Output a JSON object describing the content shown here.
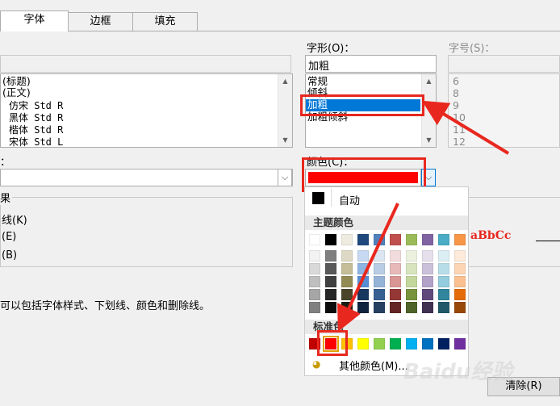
{
  "tabs": [
    {
      "label": "字体",
      "active": true
    },
    {
      "label": "边框",
      "active": false
    },
    {
      "label": "填充",
      "active": false
    }
  ],
  "font_list": {
    "items": [
      "(标题)",
      "(正文)",
      "仿宋 Std R",
      "黑体 Std R",
      "楷体 Std R",
      "宋体 Std L"
    ]
  },
  "style": {
    "label": "字形(O)：",
    "value": "加粗",
    "options": [
      "常规",
      "倾斜",
      "加粗",
      "加粗倾斜"
    ],
    "selected_index": 2
  },
  "size": {
    "label": "字号(S)：",
    "options": [
      "6",
      "8",
      "9",
      "10",
      "11",
      "12"
    ]
  },
  "underline": {
    "label": "：",
    "value": ""
  },
  "color": {
    "label": "颜色(C)：",
    "value_hex": "#ff0000"
  },
  "effects": {
    "label": "果",
    "items": [
      "线(K)",
      "(E)",
      "(B)"
    ]
  },
  "preview": {
    "text": "aBbCc"
  },
  "description": "可以包括字体样式、下划线、颜色和删除线。",
  "palette": {
    "auto_label": "自动",
    "theme_label": "主题颜色",
    "standard_label": "标准色",
    "more_label": "其他颜色(M)...",
    "theme_colors": [
      [
        "#ffffff",
        "#f2f2f2",
        "#d9d9d9",
        "#bfbfbf",
        "#a6a6a6",
        "#808080"
      ],
      [
        "#000000",
        "#7f7f7f",
        "#595959",
        "#404040",
        "#262626",
        "#0d0d0d"
      ],
      [
        "#eeece1",
        "#ddd9c4",
        "#c4bd97",
        "#948a54",
        "#4a452a",
        "#1e1c11"
      ],
      [
        "#1f497d",
        "#c6d9f1",
        "#8eb4e3",
        "#558ed5",
        "#17375e",
        "#10243f"
      ],
      [
        "#4f81bd",
        "#dce6f2",
        "#b9cde5",
        "#95b3d7",
        "#376092",
        "#254061"
      ],
      [
        "#c0504d",
        "#f2dcdb",
        "#e6b9b8",
        "#d99694",
        "#953735",
        "#632523"
      ],
      [
        "#9bbb59",
        "#ebf1de",
        "#d7e4bd",
        "#c3d69b",
        "#77933c",
        "#4f6228"
      ],
      [
        "#8064a2",
        "#e6e0ec",
        "#ccc1da",
        "#b3a2c7",
        "#604a7b",
        "#403152"
      ],
      [
        "#4bacc6",
        "#dbeef4",
        "#b7dee8",
        "#93cddd",
        "#31859c",
        "#215968"
      ],
      [
        "#f79646",
        "#fdeada",
        "#fcd5b5",
        "#fac090",
        "#e46c0a",
        "#984807"
      ]
    ],
    "standard_colors": [
      "#c00000",
      "#ff0000",
      "#ffc000",
      "#ffff00",
      "#92d050",
      "#00b050",
      "#00b0f0",
      "#0070c0",
      "#002060",
      "#7030a0"
    ],
    "selected_standard_index": 1
  },
  "buttons": {
    "clear": "清除(R)"
  },
  "watermark": "Baidu经验",
  "accent": "#0078d7",
  "highlight_red": "#e8281f"
}
